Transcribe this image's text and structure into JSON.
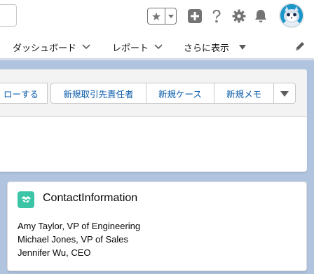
{
  "header": {
    "icons": [
      "star-icon",
      "caret-down-icon",
      "plus-icon",
      "help-icon",
      "gear-icon",
      "bell-icon",
      "avatar"
    ]
  },
  "nav": {
    "items": [
      {
        "label": "ダッシュボード"
      },
      {
        "label": "レポート"
      },
      {
        "label": "さらに表示"
      }
    ]
  },
  "actions": {
    "buttons": [
      {
        "label": "ローする"
      },
      {
        "label": "新規取引先責任者"
      },
      {
        "label": "新規ケース"
      },
      {
        "label": "新規メモ"
      }
    ]
  },
  "card": {
    "title": "ContactInformation",
    "lines": [
      "Amy Taylor, VP of Engineering",
      "Michael Jones, VP of Sales",
      "Jennifer Wu, CEO"
    ]
  },
  "colors": {
    "background": "#b0c4df",
    "link": "#0b5cab",
    "card_icon": "#3bc5a6",
    "avatar": "#1b96c9"
  }
}
